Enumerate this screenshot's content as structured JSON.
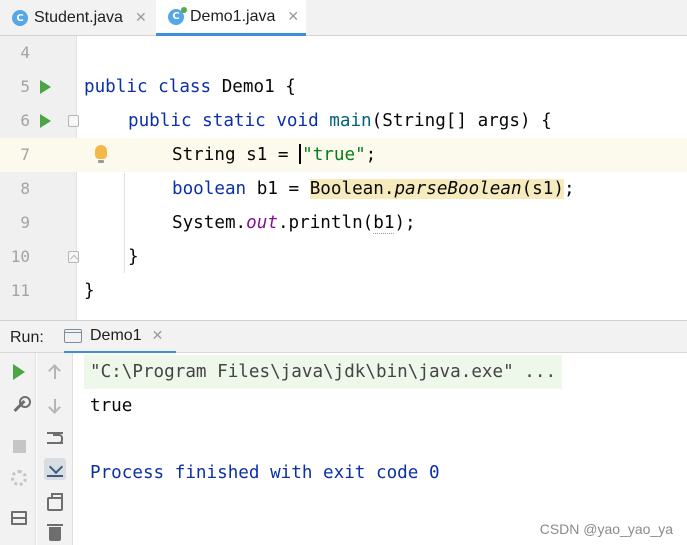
{
  "tabs": [
    {
      "label": "Student.java",
      "icon": "class-file-icon",
      "active": false
    },
    {
      "label": "Demo1.java",
      "icon": "class-file-icon",
      "active": true
    }
  ],
  "editor": {
    "line_numbers": [
      "4",
      "5",
      "6",
      "7",
      "8",
      "9",
      "10",
      "11"
    ],
    "lines": {
      "l5": {
        "kw1": "public",
        "kw2": "class",
        "rest": " Demo1 {"
      },
      "l6": {
        "kw1": "public",
        "kw2": "static",
        "kw3": "void",
        "fn": "main",
        "rest": "(String[] args) {"
      },
      "l7": {
        "pre": "String s1 = ",
        "str": "\"true\"",
        "post": ";"
      },
      "l8": {
        "kw": "boolean",
        "mid": " b1 = ",
        "cls": "Boolean.",
        "method": "parseBoolean",
        "args": "(s1)",
        "post": ";"
      },
      "l9": {
        "pre": "System.",
        "field": "out",
        "mid": ".println(",
        "arg": "b1",
        "post": ");"
      },
      "l10": {
        "text": "}"
      },
      "l11": {
        "text": "}"
      }
    }
  },
  "run_panel": {
    "label": "Run:",
    "tab_label": "Demo1",
    "output": {
      "command": "\"C:\\Program Files\\java\\jdk\\bin\\java.exe\" ...",
      "result": "true",
      "finish": "Process finished with exit code 0"
    }
  },
  "watermark": "CSDN @yao_yao_ya",
  "colors": {
    "keyword": "#0b30a8",
    "string": "#067d17",
    "method": "#00627a",
    "field": "#871094",
    "run_green": "#4aa542",
    "accent": "#3d8fd8"
  }
}
